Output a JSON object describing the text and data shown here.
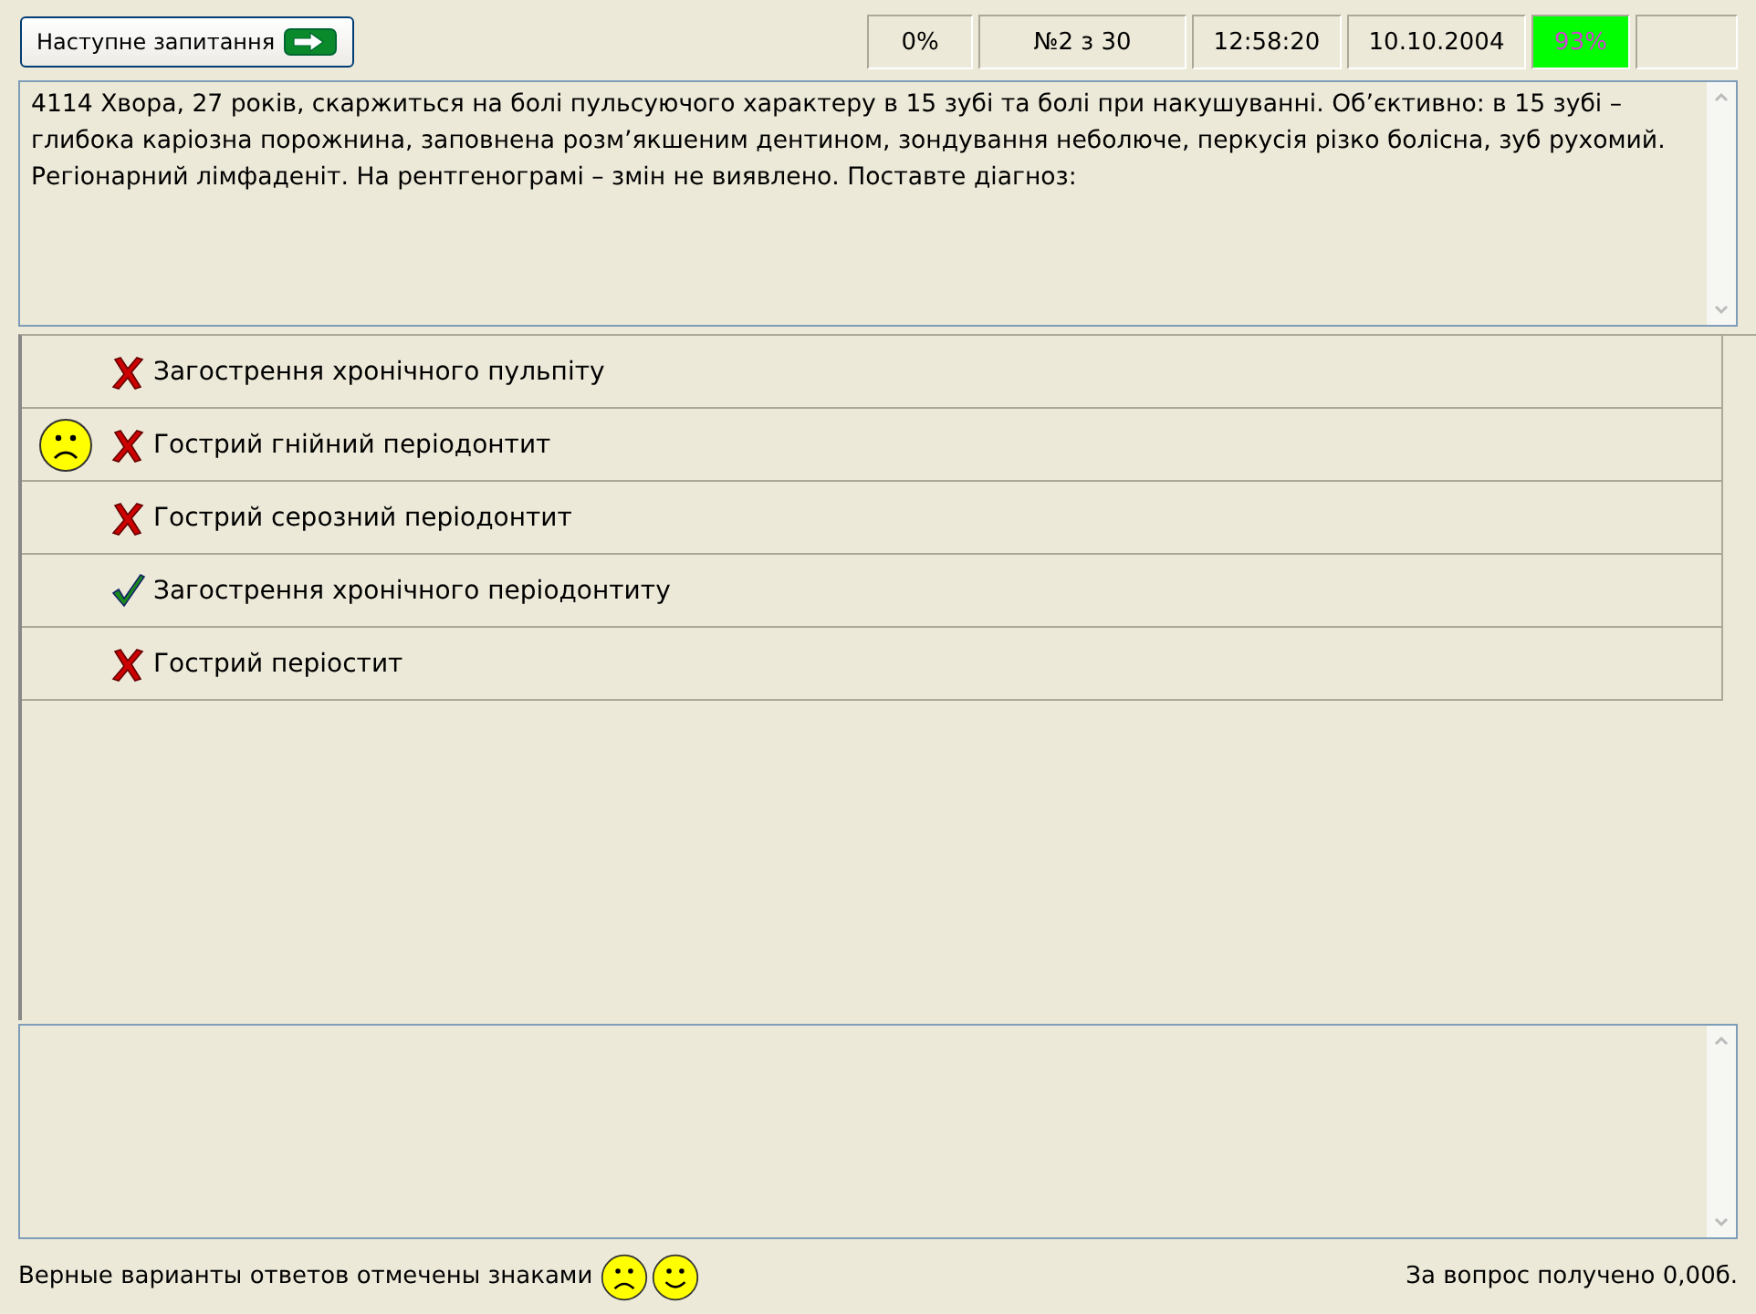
{
  "toolbar": {
    "next_button": "Наступне запитання",
    "fields": [
      "0%",
      "№2 з 30",
      "12:58:20",
      "10.10.2004"
    ],
    "score": {
      "text": "93%",
      "highlight": true
    }
  },
  "question": "4114 Хвора, 27 років, скаржиться на болі пульсуючого характеру в 15 зубі та болі при накушуванні. Об’єктивно: в 15 зубі – глибока каріозна порожнина, заповнена розм’якшеним дентином, зондування неболюче, перкусія різко болісна, зуб рухомий. Регіонарний лімфаденіт. На рентгенограмі – змін не виявлено. Поставте діагноз:",
  "answers": [
    {
      "text": "Загострення хронічного пульпіту",
      "kind": "cross",
      "selected": false
    },
    {
      "text": "Гострий гнійний періодонтит",
      "kind": "cross",
      "selected": true
    },
    {
      "text": "Гострий серозний періодонтит",
      "kind": "cross",
      "selected": false
    },
    {
      "text": "Загострення хронічного періодонтиту",
      "kind": "check",
      "selected": false
    },
    {
      "text": "Гострий періостит",
      "kind": "cross",
      "selected": false
    }
  ],
  "status_bar": {
    "legend": "Верные варианты ответов отмечены знаками",
    "score": "За вопрос получено 0,00б."
  }
}
